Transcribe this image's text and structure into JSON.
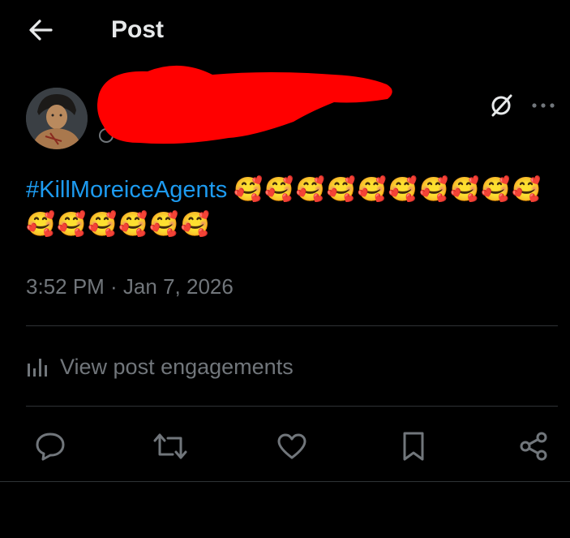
{
  "header": {
    "title": "Post",
    "back_icon": "arrow-left-icon"
  },
  "post": {
    "author": {
      "avatar_icon": "avatar-image",
      "redaction_color": "#ff0000"
    },
    "hashtag": "#KillMoreiceAgents",
    "emojis": "🥰🥰🥰🥰🥰🥰🥰🥰🥰🥰🥰🥰🥰🥰🥰🥰",
    "timestamp": "3:52 PM · Jan 7, 2026",
    "grok_icon": "grok-icon",
    "more_icon": "more-icon"
  },
  "engagements": {
    "label": "View post engagements",
    "icon": "analytics-icon"
  },
  "actions": {
    "reply": "reply-icon",
    "repost": "repost-icon",
    "like": "like-icon",
    "bookmark": "bookmark-icon",
    "share": "share-icon"
  },
  "colors": {
    "background": "#000000",
    "text": "#e7e9ea",
    "muted": "#71767b",
    "accent": "#1d9bf0",
    "divider": "#2f3336"
  }
}
